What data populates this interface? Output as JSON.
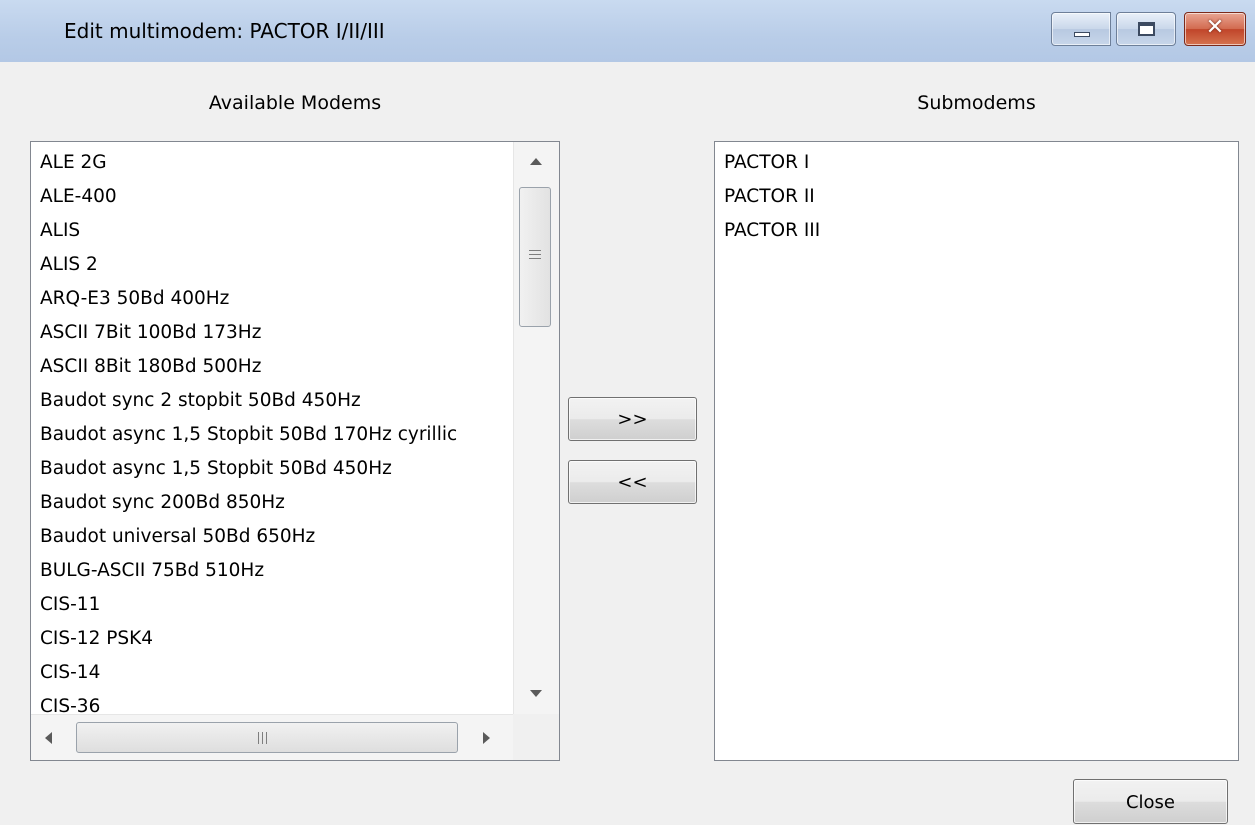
{
  "window": {
    "title": "Edit multimodem: PACTOR I/II/III",
    "controls": {
      "close_glyph": "✕"
    }
  },
  "available": {
    "label": "Available Modems",
    "items": [
      "ALE 2G",
      "ALE-400",
      "ALIS",
      "ALIS 2",
      "ARQ-E3 50Bd 400Hz",
      "ASCII 7Bit 100Bd 173Hz",
      "ASCII 8Bit 180Bd 500Hz",
      "Baudot sync 2 stopbit 50Bd 450Hz",
      "Baudot async 1,5 Stopbit 50Bd 170Hz cyrillic",
      "Baudot async 1,5 Stopbit 50Bd 450Hz",
      "Baudot sync 200Bd 850Hz",
      "Baudot universal 50Bd 650Hz",
      "BULG-ASCII 75Bd 510Hz",
      "CIS-11",
      "CIS-12 PSK4",
      "CIS-14",
      "CIS-36"
    ]
  },
  "submodems": {
    "label": "Submodems",
    "items": [
      "PACTOR I",
      "PACTOR II",
      "PACTOR III"
    ]
  },
  "buttons": {
    "add": ">>",
    "remove": "<<",
    "close": "Close"
  }
}
